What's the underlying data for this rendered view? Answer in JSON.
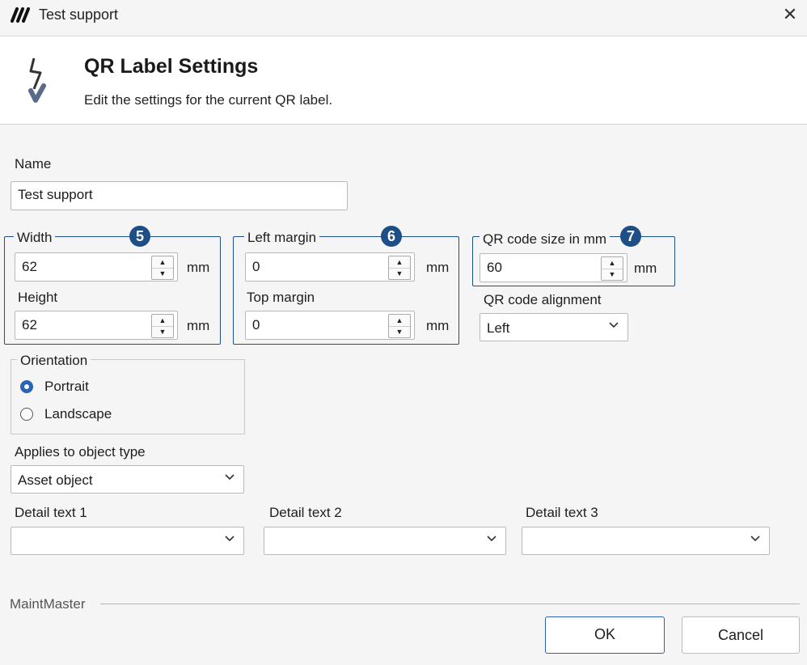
{
  "window": {
    "title": "Test support",
    "close_symbol": "✕"
  },
  "header": {
    "title": "QR Label Settings",
    "subtitle": "Edit the settings for the current QR label."
  },
  "form": {
    "name_label": "Name",
    "name_value": "Test support",
    "size_group": {
      "badge": "5",
      "width_label": "Width",
      "width_value": "62",
      "height_label": "Height",
      "height_value": "62",
      "unit": "mm"
    },
    "margin_group": {
      "badge": "6",
      "left_label": "Left margin",
      "left_value": "0",
      "top_label": "Top margin",
      "top_value": "0",
      "unit": "mm"
    },
    "qr_group": {
      "badge": "7",
      "size_label": "QR code size in mm",
      "size_value": "60",
      "unit": "mm"
    },
    "alignment": {
      "label": "QR code alignment",
      "value": "Left"
    },
    "orientation": {
      "label": "Orientation",
      "options": [
        "Portrait",
        "Landscape"
      ],
      "selected": "Portrait"
    },
    "object_type": {
      "label": "Applies to object type",
      "value": "Asset object"
    },
    "detail1": {
      "label": "Detail text 1",
      "value": ""
    },
    "detail2": {
      "label": "Detail text 2",
      "value": ""
    },
    "detail3": {
      "label": "Detail text 3",
      "value": ""
    }
  },
  "footer": {
    "brand": "MaintMaster",
    "ok_label": "OK",
    "cancel_label": "Cancel"
  },
  "colors": {
    "accent": "#1d4f86",
    "primary_button_border": "#2a62b8",
    "radio_selected": "#2a62b8"
  }
}
